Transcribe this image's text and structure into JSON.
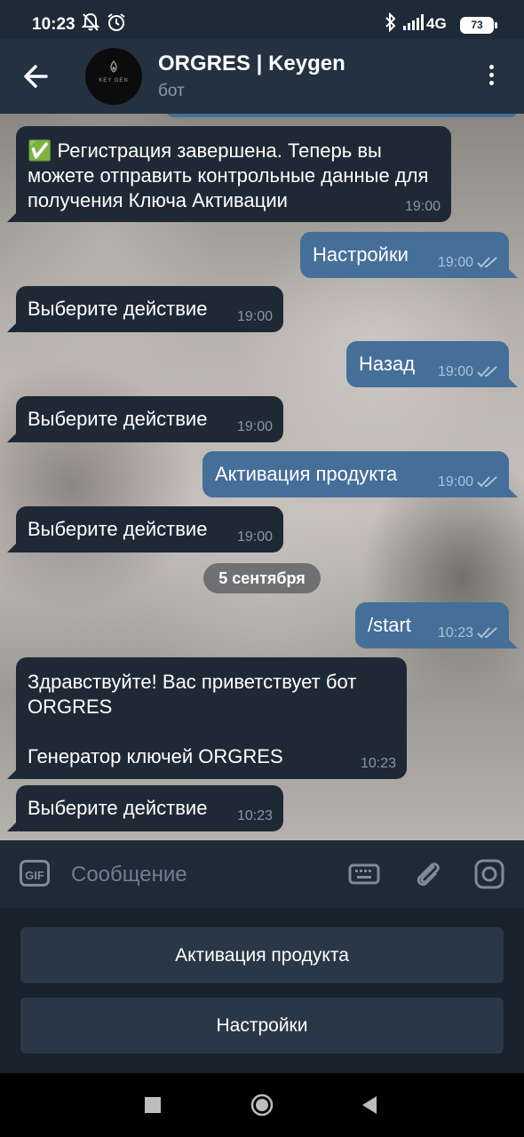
{
  "status_bar": {
    "time": "10:23",
    "network": "4G",
    "battery": "73",
    "icons": [
      "notifications-off-icon",
      "alarm-icon",
      "bluetooth-icon",
      "signal-icon"
    ]
  },
  "header": {
    "back_icon": "arrow-left-icon",
    "avatar_text": "KEY GEN",
    "title": "ORGRES | Keygen",
    "subtitle": "бот",
    "menu_icon": "more-vert-icon"
  },
  "chat": {
    "date_separator": "5 сентября",
    "messages": [
      {
        "dir": "in",
        "text": "✅ Регистрация завершена. Теперь вы можете отправить контрольные данные для получения Ключа Активации",
        "time": "19:00"
      },
      {
        "dir": "out",
        "text": "Настройки",
        "time": "19:00",
        "read": true
      },
      {
        "dir": "in",
        "text": "Выберите действие",
        "time": "19:00"
      },
      {
        "dir": "out",
        "text": "Назад",
        "time": "19:00",
        "read": true
      },
      {
        "dir": "in",
        "text": "Выберите действие",
        "time": "19:00"
      },
      {
        "dir": "out",
        "text": "Активация продукта",
        "time": "19:00",
        "read": true
      },
      {
        "dir": "in",
        "text": "Выберите действие",
        "time": "19:00"
      },
      {
        "dir": "out",
        "text": "/start",
        "time": "10:23",
        "read": true
      },
      {
        "dir": "in",
        "text": "Здравствуйте! Вас приветствует бот ORGRES\n\nГенератор ключей ORGRES",
        "time": "10:23"
      },
      {
        "dir": "in",
        "text": "Выберите действие",
        "time": "10:23"
      }
    ]
  },
  "input_bar": {
    "gif_label": "GIF",
    "placeholder": "Сообщение",
    "icons": [
      "keyboard-icon",
      "attach-icon",
      "camera-icon"
    ]
  },
  "bot_keyboard": {
    "buttons": [
      "Активация продукта",
      "Настройки"
    ]
  },
  "nav_bar": {
    "icons": [
      "recents-icon",
      "home-icon",
      "back-icon"
    ]
  },
  "colors": {
    "header_bg": "#243140",
    "incoming_bubble": "#1f2936",
    "outgoing_bubble": "#456f99",
    "keyboard_button": "#2a3746"
  }
}
